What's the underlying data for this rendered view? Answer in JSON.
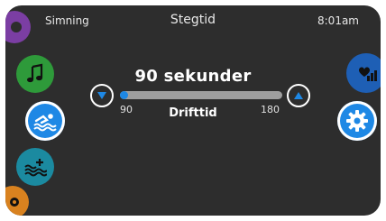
{
  "header": {
    "left_label": "Simning",
    "title": "Stegtid",
    "time": "8:01am"
  },
  "setting": {
    "value_text": "90 sekunder",
    "label": "Drifttid",
    "min_label": "90",
    "max_label": "180",
    "slider_fraction": 0.0
  },
  "colors": {
    "background": "#2d2d2d",
    "accent_blue": "#1e88e5",
    "green": "#2e9a3a",
    "teal": "#1b8aa0",
    "purple": "#7b3ea3",
    "orange": "#d9821f"
  },
  "icons": {
    "left_rail": [
      "partial-purple-icon",
      "music-icon",
      "swim-icon",
      "water-heat-icon",
      "partial-gear-icon"
    ],
    "right_rail": [
      "heart-signal-icon",
      "settings-gear-icon"
    ],
    "slider_buttons": [
      "decrease-arrow-icon",
      "increase-arrow-icon"
    ]
  }
}
